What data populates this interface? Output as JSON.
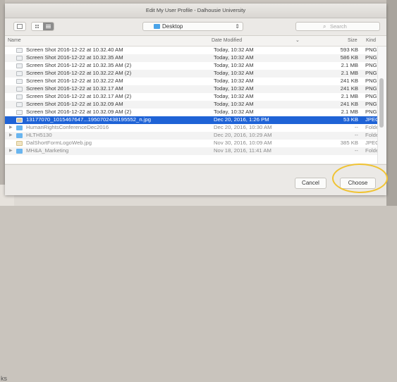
{
  "background": {
    "left_text": "ks"
  },
  "dialog": {
    "title": "Edit My User Profile - Dalhousie University"
  },
  "toolbar": {
    "view_icon_label": "sidebar-toggle",
    "location": "Desktop",
    "search_placeholder": "Search"
  },
  "columns": {
    "name": "Name",
    "date": "Date Modified",
    "size": "Size",
    "kind": "Kind"
  },
  "files": [
    {
      "name": "Screen Shot 2016-12-22 at 10.32.40 AM",
      "date": "Today, 10:32 AM",
      "size": "593 KB",
      "kind": "PNG",
      "icon": "screenshot-icon",
      "dim": false,
      "selected": false,
      "folder": false
    },
    {
      "name": "Screen Shot 2016-12-22 at 10.32.35 AM",
      "date": "Today, 10:32 AM",
      "size": "586 KB",
      "kind": "PNG",
      "icon": "screenshot-icon",
      "dim": false,
      "selected": false,
      "folder": false
    },
    {
      "name": "Screen Shot 2016-12-22 at 10.32.35 AM (2)",
      "date": "Today, 10:32 AM",
      "size": "2.1 MB",
      "kind": "PNG",
      "icon": "screenshot-icon",
      "dim": false,
      "selected": false,
      "folder": false
    },
    {
      "name": "Screen Shot 2016-12-22 at 10.32.22 AM (2)",
      "date": "Today, 10:32 AM",
      "size": "2.1 MB",
      "kind": "PNG",
      "icon": "screenshot-icon",
      "dim": false,
      "selected": false,
      "folder": false
    },
    {
      "name": "Screen Shot 2016-12-22 at 10.32.22 AM",
      "date": "Today, 10:32 AM",
      "size": "241 KB",
      "kind": "PNG",
      "icon": "screenshot-icon",
      "dim": false,
      "selected": false,
      "folder": false
    },
    {
      "name": "Screen Shot 2016-12-22 at 10.32.17 AM",
      "date": "Today, 10:32 AM",
      "size": "241 KB",
      "kind": "PNG",
      "icon": "screenshot-icon",
      "dim": false,
      "selected": false,
      "folder": false
    },
    {
      "name": "Screen Shot 2016-12-22 at 10.32.17 AM (2)",
      "date": "Today, 10:32 AM",
      "size": "2.1 MB",
      "kind": "PNG",
      "icon": "screenshot-icon",
      "dim": false,
      "selected": false,
      "folder": false
    },
    {
      "name": "Screen Shot 2016-12-22 at 10.32.09 AM",
      "date": "Today, 10:32 AM",
      "size": "241 KB",
      "kind": "PNG",
      "icon": "screenshot-icon",
      "dim": false,
      "selected": false,
      "folder": false
    },
    {
      "name": "Screen Shot 2016-12-22 at 10.32.09 AM (2)",
      "date": "Today, 10:32 AM",
      "size": "2.1 MB",
      "kind": "PNG",
      "icon": "screenshot-icon",
      "dim": false,
      "selected": false,
      "folder": false
    },
    {
      "name": "13177070_1015467647...1950702438195552_n.jpg",
      "date": "Dec 20, 2016, 1:26 PM",
      "size": "53 KB",
      "kind": "JPEG",
      "icon": "jpeg-icon",
      "dim": false,
      "selected": true,
      "folder": false
    },
    {
      "name": "HumanRightsConferenceDec2016",
      "date": "Dec 20, 2016, 10:30 AM",
      "size": "--",
      "kind": "Folder",
      "icon": "folder-icon",
      "dim": true,
      "selected": false,
      "folder": true
    },
    {
      "name": "HLTH5130",
      "date": "Dec 20, 2016, 10:29 AM",
      "size": "--",
      "kind": "Folder",
      "icon": "folder-icon",
      "dim": true,
      "selected": false,
      "folder": true
    },
    {
      "name": "DalShortFormLogoWeb.jpg",
      "date": "Nov 30, 2016, 10:09 AM",
      "size": "385 KB",
      "kind": "JPEG",
      "icon": "jpeg-icon",
      "dim": true,
      "selected": false,
      "folder": false
    },
    {
      "name": "MH&A_Marketing",
      "date": "Nov 18, 2016, 11:41 AM",
      "size": "--",
      "kind": "Folder",
      "icon": "folder-icon",
      "dim": true,
      "selected": false,
      "folder": true
    }
  ],
  "buttons": {
    "cancel": "Cancel",
    "choose": "Choose"
  },
  "colors": {
    "selection": "#1f63d6",
    "highlight_ring": "#f0c332",
    "folder": "#69b5ef"
  }
}
